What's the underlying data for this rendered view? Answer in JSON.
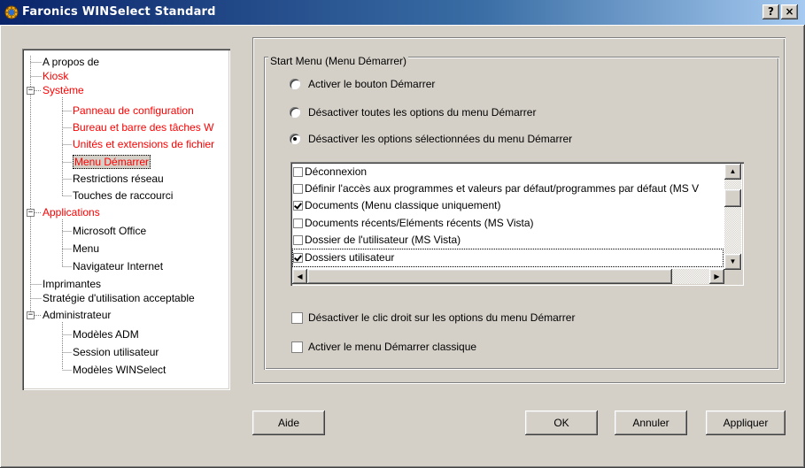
{
  "window": {
    "title": "Faronics WINSelect Standard",
    "help_btn": "?",
    "close_btn": "×"
  },
  "tree": {
    "nodes": [
      {
        "label": "A propos de"
      },
      {
        "label": "Kiosk"
      },
      {
        "label": "Système"
      },
      {
        "label": "Panneau de configuration"
      },
      {
        "label": "Bureau et barre des tâches W"
      },
      {
        "label": "Unités et extensions de fichier"
      },
      {
        "label": "Menu Démarrer"
      },
      {
        "label": "Restrictions réseau"
      },
      {
        "label": "Touches de raccourci"
      },
      {
        "label": "Applications"
      },
      {
        "label": "Microsoft Office"
      },
      {
        "label": "Menu"
      },
      {
        "label": "Navigateur Internet"
      },
      {
        "label": "Imprimantes"
      },
      {
        "label": "Stratégie d'utilisation acceptable"
      },
      {
        "label": "Administrateur"
      },
      {
        "label": "Modèles ADM"
      },
      {
        "label": "Session utilisateur"
      },
      {
        "label": "Modèles WINSelect"
      }
    ],
    "expander_minus": "−"
  },
  "group": {
    "label": "Start Menu (Menu Démarrer)",
    "radios": [
      {
        "label": "Activer le bouton Démarrer",
        "selected": false
      },
      {
        "label": "Désactiver toutes les options du menu Démarrer",
        "selected": false
      },
      {
        "label": "Désactiver les options sélectionnées du menu Démarrer",
        "selected": true
      }
    ],
    "list": [
      {
        "label": "Déconnexion",
        "checked": false
      },
      {
        "label": "Définir l'accès aux programmes et valeurs par défaut/programmes par défaut (MS V",
        "checked": false
      },
      {
        "label": "Documents (Menu classique uniquement)",
        "checked": true
      },
      {
        "label": "Documents récents/Eléments récents (MS Vista)",
        "checked": false
      },
      {
        "label": "Dossier de l'utilisateur (MS Vista)",
        "checked": false
      },
      {
        "label": "Dossiers utilisateur",
        "checked": true
      }
    ],
    "checkboxes": [
      {
        "label": "Désactiver le clic droit sur les options du menu Démarrer",
        "checked": false
      },
      {
        "label": "Activer le menu Démarrer classique",
        "checked": false
      }
    ]
  },
  "buttons": {
    "help": "Aide",
    "ok": "OK",
    "cancel": "Annuler",
    "apply": "Appliquer"
  }
}
